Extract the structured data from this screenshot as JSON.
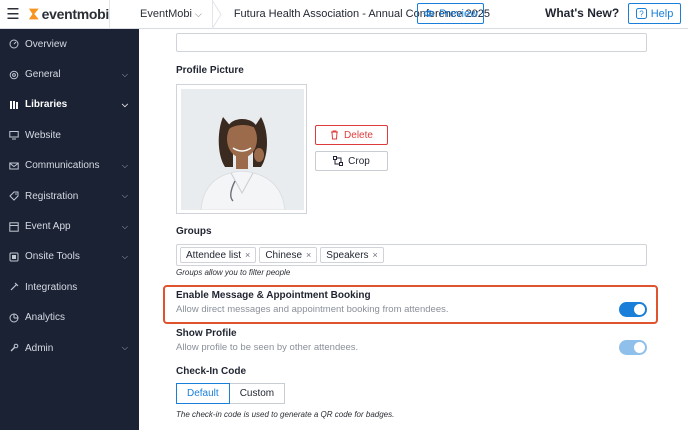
{
  "header": {
    "logo_text": "eventmobi",
    "org_name": "EventMobi",
    "event_title": "Futura Health Association - Annual Conference 2025",
    "preview_label": "Preview",
    "whats_new_label": "What's New?",
    "help_label": "Help"
  },
  "sidebar": {
    "items": [
      {
        "label": "Overview",
        "icon": "dashboard-icon",
        "has_caret": false
      },
      {
        "label": "General",
        "icon": "gear-icon",
        "has_caret": true
      },
      {
        "label": "Libraries",
        "icon": "library-icon",
        "has_caret": true,
        "active": true
      },
      {
        "label": "Website",
        "icon": "monitor-icon",
        "has_caret": false
      },
      {
        "label": "Communications",
        "icon": "envelope-icon",
        "has_caret": true
      },
      {
        "label": "Registration",
        "icon": "tag-icon",
        "has_caret": true
      },
      {
        "label": "Event App",
        "icon": "app-icon",
        "has_caret": true
      },
      {
        "label": "Onsite Tools",
        "icon": "badge-icon",
        "has_caret": true
      },
      {
        "label": "Integrations",
        "icon": "plug-icon",
        "has_caret": false
      },
      {
        "label": "Analytics",
        "icon": "chart-icon",
        "has_caret": false
      },
      {
        "label": "Admin",
        "icon": "wrench-icon",
        "has_caret": true
      }
    ]
  },
  "profile_picture": {
    "label": "Profile Picture",
    "delete_label": "Delete",
    "crop_label": "Crop"
  },
  "groups": {
    "label": "Groups",
    "tags": [
      "Attendee list",
      "Chinese",
      "Speakers"
    ],
    "hint": "Groups allow you to filter people"
  },
  "enable_messaging": {
    "title": "Enable Message & Appointment Booking",
    "description": "Allow direct messages and appointment booking from attendees.",
    "enabled": true
  },
  "show_profile": {
    "title": "Show Profile",
    "description": "Allow profile to be seen by other attendees.",
    "enabled": true
  },
  "checkin": {
    "label": "Check-In Code",
    "options": [
      "Default",
      "Custom"
    ],
    "selected": "Default",
    "hint": "The check-in code is used to generate a QR code for badges."
  },
  "colors": {
    "accent": "#1a7fd9",
    "sidebar_bg": "#1b2233",
    "highlight": "#e0532f",
    "danger": "#e03b3b",
    "logo_orange": "#f7931e"
  }
}
